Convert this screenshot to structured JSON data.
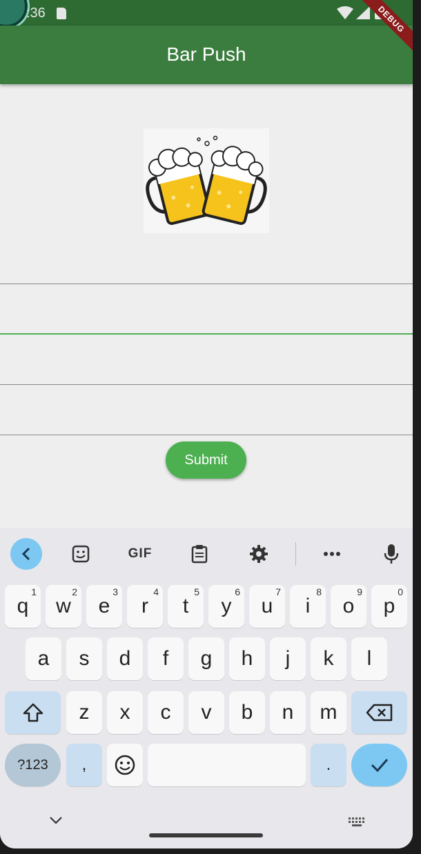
{
  "status_bar": {
    "time": ":36"
  },
  "app_bar": {
    "title": "Bar Push",
    "debug_label": "DEBUG"
  },
  "form": {
    "fields": [
      {
        "value": "",
        "placeholder": ""
      },
      {
        "value": "",
        "placeholder": ""
      },
      {
        "value": "",
        "placeholder": ""
      },
      {
        "value": "",
        "placeholder": ""
      }
    ],
    "submit_label": "Submit"
  },
  "keyboard": {
    "toolbar": {
      "gif_label": "GIF"
    },
    "row1": [
      {
        "label": "q",
        "hint": "1"
      },
      {
        "label": "w",
        "hint": "2"
      },
      {
        "label": "e",
        "hint": "3"
      },
      {
        "label": "r",
        "hint": "4"
      },
      {
        "label": "t",
        "hint": "5"
      },
      {
        "label": "y",
        "hint": "6"
      },
      {
        "label": "u",
        "hint": "7"
      },
      {
        "label": "i",
        "hint": "8"
      },
      {
        "label": "o",
        "hint": "9"
      },
      {
        "label": "p",
        "hint": "0"
      }
    ],
    "row2": [
      "a",
      "s",
      "d",
      "f",
      "g",
      "h",
      "j",
      "k",
      "l"
    ],
    "row3": [
      "z",
      "x",
      "c",
      "v",
      "b",
      "n",
      "m"
    ],
    "row4": {
      "symbols": "?123",
      "comma": ",",
      "period": "."
    }
  },
  "colors": {
    "status_bar": "#2e6b33",
    "app_bar": "#3b7d3f",
    "accent": "#4caf50",
    "debug_ribbon": "#8b1c1c",
    "keyboard_accent": "#7cc8f3"
  }
}
